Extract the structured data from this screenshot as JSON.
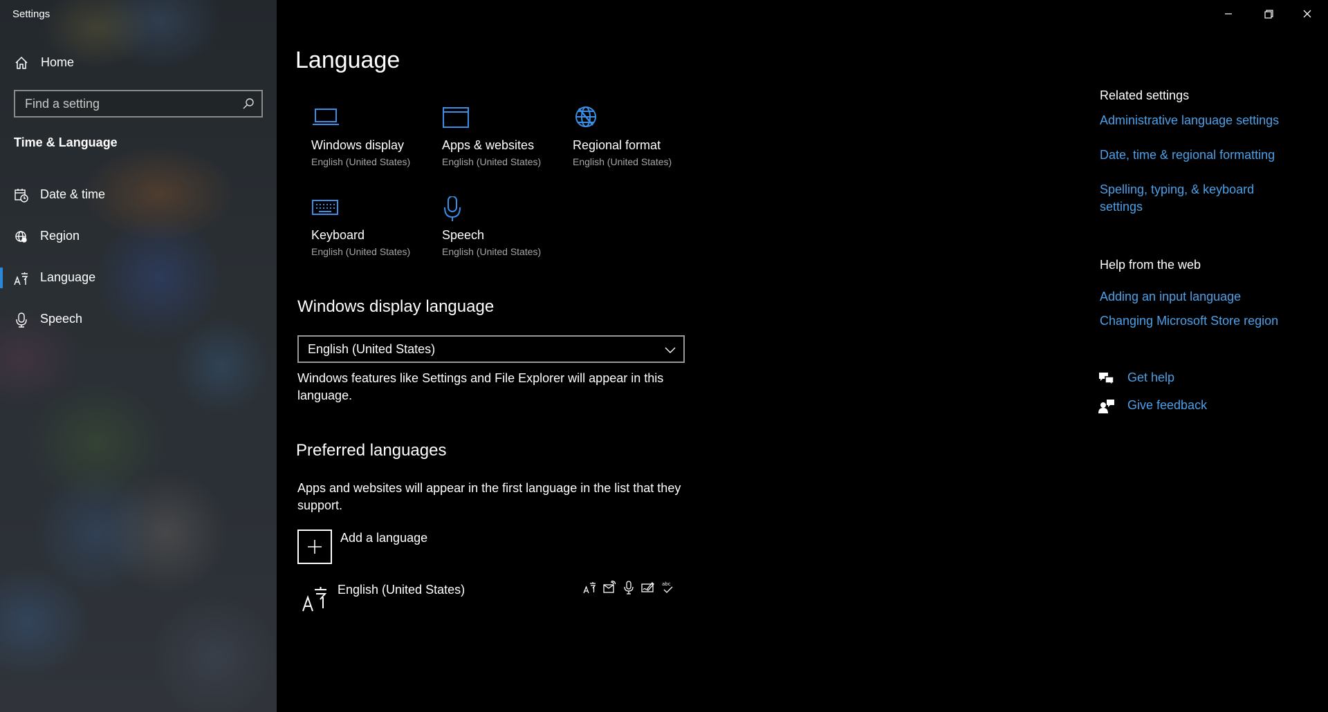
{
  "window": {
    "title": "Settings"
  },
  "sidebar": {
    "home_label": "Home",
    "search_placeholder": "Find a setting",
    "section_title": "Time & Language",
    "items": [
      {
        "label": "Date & time",
        "icon": "calendar-clock-icon",
        "active": false
      },
      {
        "label": "Region",
        "icon": "globe-icon",
        "active": false
      },
      {
        "label": "Language",
        "icon": "language-icon",
        "active": true
      },
      {
        "label": "Speech",
        "icon": "microphone-icon",
        "active": false
      }
    ]
  },
  "main": {
    "title": "Language",
    "tiles": [
      {
        "title": "Windows display",
        "subtitle": "English (United States)",
        "icon": "laptop-icon"
      },
      {
        "title": "Apps & websites",
        "subtitle": "English (United States)",
        "icon": "browser-window-icon"
      },
      {
        "title": "Regional format",
        "subtitle": "English (United States)",
        "icon": "globe-grid-icon"
      },
      {
        "title": "Keyboard",
        "subtitle": "English (United States)",
        "icon": "keyboard-icon"
      },
      {
        "title": "Speech",
        "subtitle": "English (United States)",
        "icon": "microphone-icon"
      }
    ],
    "display_language": {
      "heading": "Windows display language",
      "selected": "English (United States)",
      "description": "Windows features like Settings and File Explorer will appear in this language."
    },
    "preferred": {
      "heading": "Preferred languages",
      "description": "Apps and websites will appear in the first language in the list that they support.",
      "add_label": "Add a language",
      "languages": [
        {
          "name": "English (United States)",
          "features": [
            "display-language-icon",
            "text-to-speech-icon",
            "speech-recognition-icon",
            "handwriting-icon",
            "spell-check-icon"
          ]
        }
      ]
    }
  },
  "related": {
    "heading": "Related settings",
    "links": [
      "Administrative language settings",
      "Date, time & regional formatting",
      "Spelling, typing, & keyboard settings"
    ]
  },
  "help": {
    "heading": "Help from the web",
    "links": [
      "Adding an input language",
      "Changing Microsoft Store region"
    ],
    "get_help": "Get help",
    "give_feedback": "Give feedback"
  },
  "colors": {
    "accent": "#4ba0e8",
    "active_bar": "#2b88d8",
    "tile_icon": "#3a8ee6"
  }
}
